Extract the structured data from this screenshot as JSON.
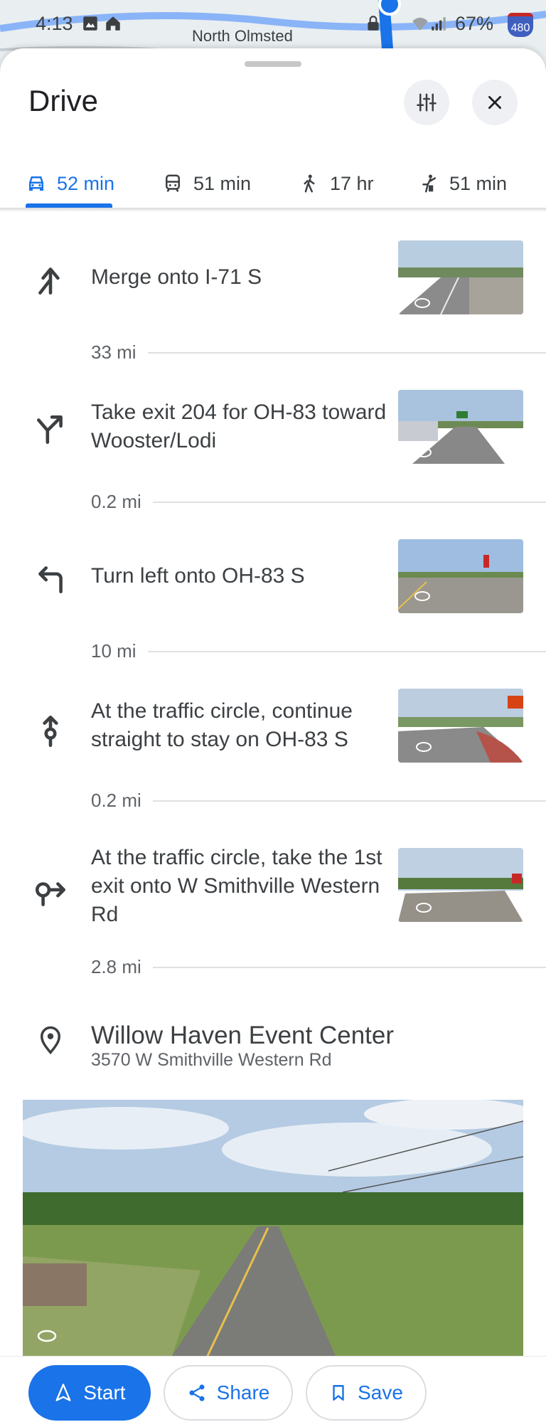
{
  "status_bar": {
    "time": "4:13",
    "battery": "67%",
    "map_label": "North Olmsted",
    "shield": "480"
  },
  "sheet": {
    "title": "Drive"
  },
  "header_buttons": {
    "options_icon": "tune-icon",
    "close_icon": "close-icon"
  },
  "tabs": [
    {
      "mode": "drive",
      "label": "52 min",
      "active": true
    },
    {
      "mode": "transit",
      "label": "51 min",
      "active": false
    },
    {
      "mode": "walk",
      "label": "17 hr",
      "active": false
    },
    {
      "mode": "ride",
      "label": "51 min",
      "active": false
    }
  ],
  "steps": [
    {
      "icon": "merge-icon",
      "text": "Merge onto I-71 S"
    },
    {
      "icon": "exit-right-icon",
      "text": "Take exit 204 for OH-83 toward Wooster/Lodi"
    },
    {
      "icon": "turn-left-icon",
      "text": "Turn left onto OH-83 S"
    },
    {
      "icon": "roundabout-straight-icon",
      "text": "At the traffic circle, continue straight to stay on OH-83 S"
    },
    {
      "icon": "roundabout-exit-icon",
      "text": "At the traffic circle, take the 1st exit onto W Smithville Western Rd"
    }
  ],
  "distances": [
    "33 mi",
    "0.2 mi",
    "10 mi",
    "0.2 mi",
    "2.8 mi"
  ],
  "destination": {
    "name": "Willow Haven Event Center",
    "address": "3570 W Smithville Western Rd"
  },
  "actions": {
    "start": "Start",
    "share": "Share",
    "save": "Save"
  },
  "colors": {
    "accent": "#1a73e8",
    "text": "#3c4043",
    "muted": "#5f6368"
  }
}
